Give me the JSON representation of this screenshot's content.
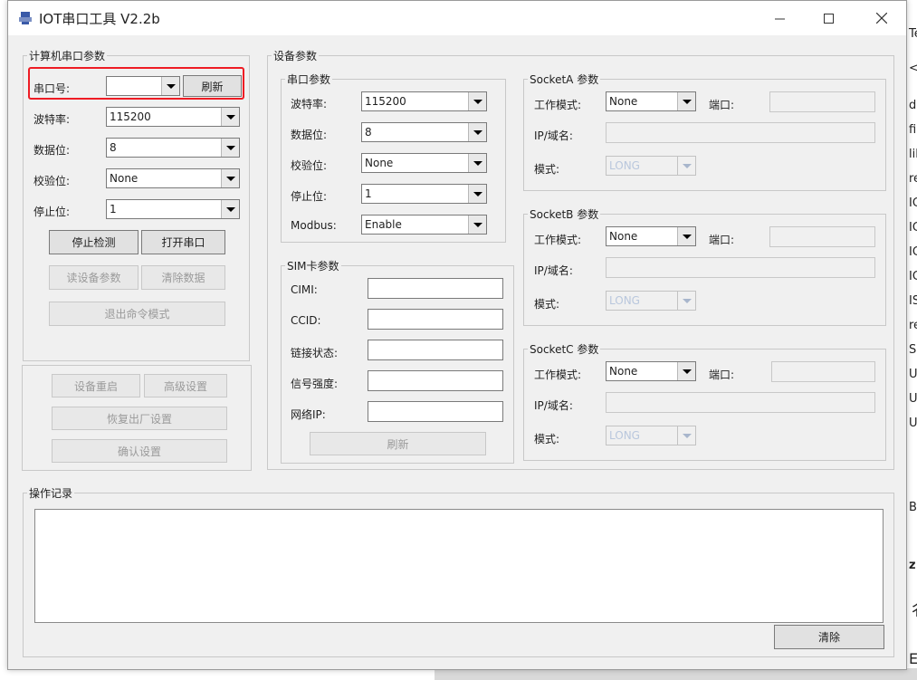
{
  "window": {
    "title": "IOT串口工具 V2.2b",
    "icon_text": "MBT",
    "min_glyph": "—",
    "max_glyph": "☐",
    "close_glyph": "✕"
  },
  "pc_serial": {
    "group_title": "计算机串口参数",
    "port_label": "串口号:",
    "port_value": "",
    "refresh_button": "刷新",
    "baud_label": "波特率:",
    "baud_value": "115200",
    "databits_label": "数据位:",
    "databits_value": "8",
    "parity_label": "校验位:",
    "parity_value": "None",
    "stopbits_label": "停止位:",
    "stopbits_value": "1",
    "stop_detect_button": "停止检测",
    "open_port_button": "打开串口",
    "read_params_button": "读设备参数",
    "clear_data_button": "清除数据",
    "exit_cmd_button": "退出命令模式"
  },
  "device_actions": {
    "restart_button": "设备重启",
    "advanced_button": "高级设置",
    "factory_reset_button": "恢复出厂设置",
    "confirm_button": "确认设置"
  },
  "device_params": {
    "group_title": "设备参数",
    "serial": {
      "group_title": "串口参数",
      "baud_label": "波特率:",
      "baud_value": "115200",
      "databits_label": "数据位:",
      "databits_value": "8",
      "parity_label": "校验位:",
      "parity_value": "None",
      "stopbits_label": "停止位:",
      "stopbits_value": "1",
      "modbus_label": "Modbus:",
      "modbus_value": "Enable"
    },
    "sim": {
      "group_title": "SIM卡参数",
      "cimi_label": "CIMI:",
      "ccid_label": "CCID:",
      "link_label": "链接状态:",
      "signal_label": "信号强度:",
      "ip_label": "网络IP:",
      "refresh_button": "刷新"
    },
    "sockets": [
      {
        "title": "SocketA 参数",
        "mode_label": "工作模式:",
        "mode_value": "None",
        "port_label": "端口:",
        "ip_label": "IP/域名:",
        "type_label": "模式:",
        "type_value": "LONG"
      },
      {
        "title": "SocketB 参数",
        "mode_label": "工作模式:",
        "mode_value": "None",
        "port_label": "端口:",
        "ip_label": "IP/域名:",
        "type_label": "模式:",
        "type_value": "LONG"
      },
      {
        "title": "SocketC 参数",
        "mode_label": "工作模式:",
        "mode_value": "None",
        "port_label": "端口:",
        "ip_label": "IP/域名:",
        "type_label": "模式:",
        "type_value": "LONG"
      }
    ]
  },
  "log": {
    "group_title": "操作记录",
    "clear_button": "清除"
  },
  "background_window": {
    "letters": [
      "Te",
      "<",
      "d",
      "fi",
      "lil",
      "re",
      "IC",
      "IC",
      "IC",
      "IC",
      "IS",
      "re",
      "S",
      "U",
      "U",
      "U",
      "B",
      "z",
      "彳",
      "E"
    ]
  },
  "colors": {
    "highlight": "#ee1c24",
    "window_bg": "#f0f0f0",
    "disabled_text": "#b9c7dd"
  }
}
